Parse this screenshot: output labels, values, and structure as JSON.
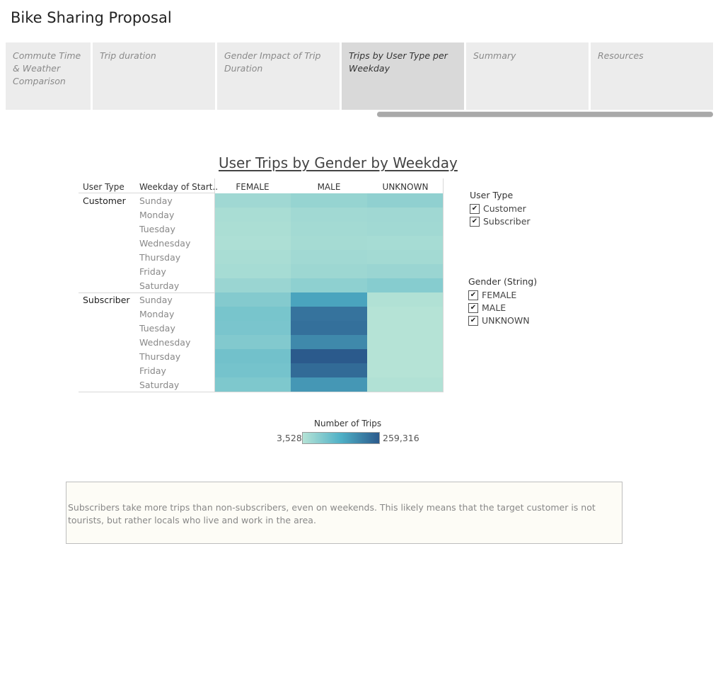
{
  "story": {
    "title": "Bike Sharing Proposal"
  },
  "tabs": [
    {
      "label": "Commute Time & Weather Comparison",
      "active": false
    },
    {
      "label": "Trip duration",
      "active": false
    },
    {
      "label": "Gender Impact of Trip Duration",
      "active": false
    },
    {
      "label": "Trips by User Type per Weekday",
      "active": true
    },
    {
      "label": "Summary",
      "active": false
    },
    {
      "label": "Resources",
      "active": false
    }
  ],
  "chart_data": {
    "type": "heatmap",
    "title": "User Trips by Gender by Weekday",
    "row_headers": [
      "User Type",
      "Weekday of Start.."
    ],
    "columns": [
      "FEMALE",
      "MALE",
      "UNKNOWN"
    ],
    "groups": [
      {
        "name": "Customer",
        "rows": [
          {
            "weekday": "Sunday",
            "values": [
              30000,
              42000,
              50000
            ]
          },
          {
            "weekday": "Monday",
            "values": [
              18000,
              28000,
              30000
            ]
          },
          {
            "weekday": "Tuesday",
            "values": [
              16000,
              26000,
              28000
            ]
          },
          {
            "weekday": "Wednesday",
            "values": [
              14000,
              24000,
              22000
            ]
          },
          {
            "weekday": "Thursday",
            "values": [
              18000,
              28000,
              26000
            ]
          },
          {
            "weekday": "Friday",
            "values": [
              22000,
              34000,
              38000
            ]
          },
          {
            "weekday": "Saturday",
            "values": [
              38000,
              52000,
              62000
            ]
          }
        ]
      },
      {
        "name": "Subscriber",
        "rows": [
          {
            "weekday": "Sunday",
            "values": [
              65000,
              150000,
              8000
            ]
          },
          {
            "weekday": "Monday",
            "values": [
              80000,
              222000,
              4000
            ]
          },
          {
            "weekday": "Tuesday",
            "values": [
              78000,
              226000,
              4000
            ]
          },
          {
            "weekday": "Wednesday",
            "values": [
              68000,
              190000,
              4000
            ]
          },
          {
            "weekday": "Thursday",
            "values": [
              88000,
              259316,
              3528
            ]
          },
          {
            "weekday": "Friday",
            "values": [
              84000,
              234000,
              4000
            ]
          },
          {
            "weekday": "Saturday",
            "values": [
              72000,
              168000,
              8000
            ]
          }
        ]
      }
    ],
    "color_scale": {
      "title": "Number of Trips",
      "min_label": "3,528",
      "max_label": "259,316",
      "min": 3528,
      "max": 259316,
      "stops": [
        "#b5e3d6",
        "#4fb0c6",
        "#2b5a8c"
      ]
    }
  },
  "filters": [
    {
      "title": "User Type",
      "items": [
        {
          "label": "Customer",
          "checked": true
        },
        {
          "label": "Subscriber",
          "checked": true
        }
      ]
    },
    {
      "title": "Gender (String)",
      "items": [
        {
          "label": "FEMALE",
          "checked": true
        },
        {
          "label": "MALE",
          "checked": true
        },
        {
          "label": "UNKNOWN",
          "checked": true
        }
      ]
    }
  ],
  "check_glyph": "✔",
  "note": {
    "text": "Subscribers take more trips than non-subscribers, even on weekends.  This likely means that the target customer is not tourists, but rather locals who live and work in the area."
  }
}
